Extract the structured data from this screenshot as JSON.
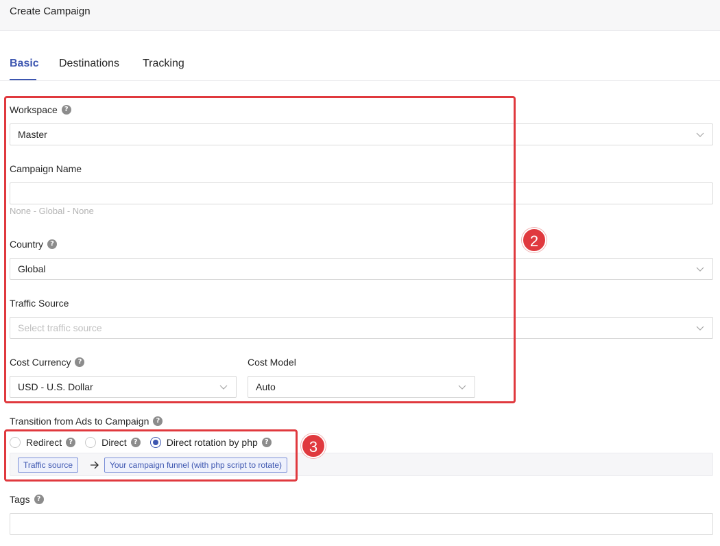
{
  "header": {
    "title": "Create Campaign"
  },
  "tabs": [
    {
      "label": "Basic",
      "active": true
    },
    {
      "label": "Destinations",
      "active": false
    },
    {
      "label": "Tracking",
      "active": false
    }
  ],
  "form": {
    "workspace": {
      "label": "Workspace",
      "value": "Master"
    },
    "campaign_name": {
      "label": "Campaign Name",
      "value": "",
      "hint": "None - Global - None"
    },
    "country": {
      "label": "Country",
      "value": "Global"
    },
    "traffic_source": {
      "label": "Traffic Source",
      "placeholder": "Select traffic source"
    },
    "cost_currency": {
      "label": "Cost Currency",
      "value": "USD - U.S. Dollar"
    },
    "cost_model": {
      "label": "Cost Model",
      "value": "Auto"
    },
    "transition": {
      "label": "Transition from Ads to Campaign",
      "options": [
        {
          "label": "Redirect",
          "checked": false
        },
        {
          "label": "Direct",
          "checked": false
        },
        {
          "label": "Direct rotation by php",
          "checked": true
        }
      ],
      "flow": {
        "from": "Traffic source",
        "to": "Your campaign funnel (with php script to rotate)"
      }
    },
    "tags": {
      "label": "Tags",
      "value": ""
    }
  },
  "annotations": {
    "badge_2": "2",
    "badge_3": "3"
  },
  "colors": {
    "accent": "#3d56b0",
    "annotation": "#e0393e"
  },
  "icons": {
    "help": "question-circle-icon",
    "dropdown": "chevron-down-icon",
    "arrow": "arrow-right-icon"
  }
}
